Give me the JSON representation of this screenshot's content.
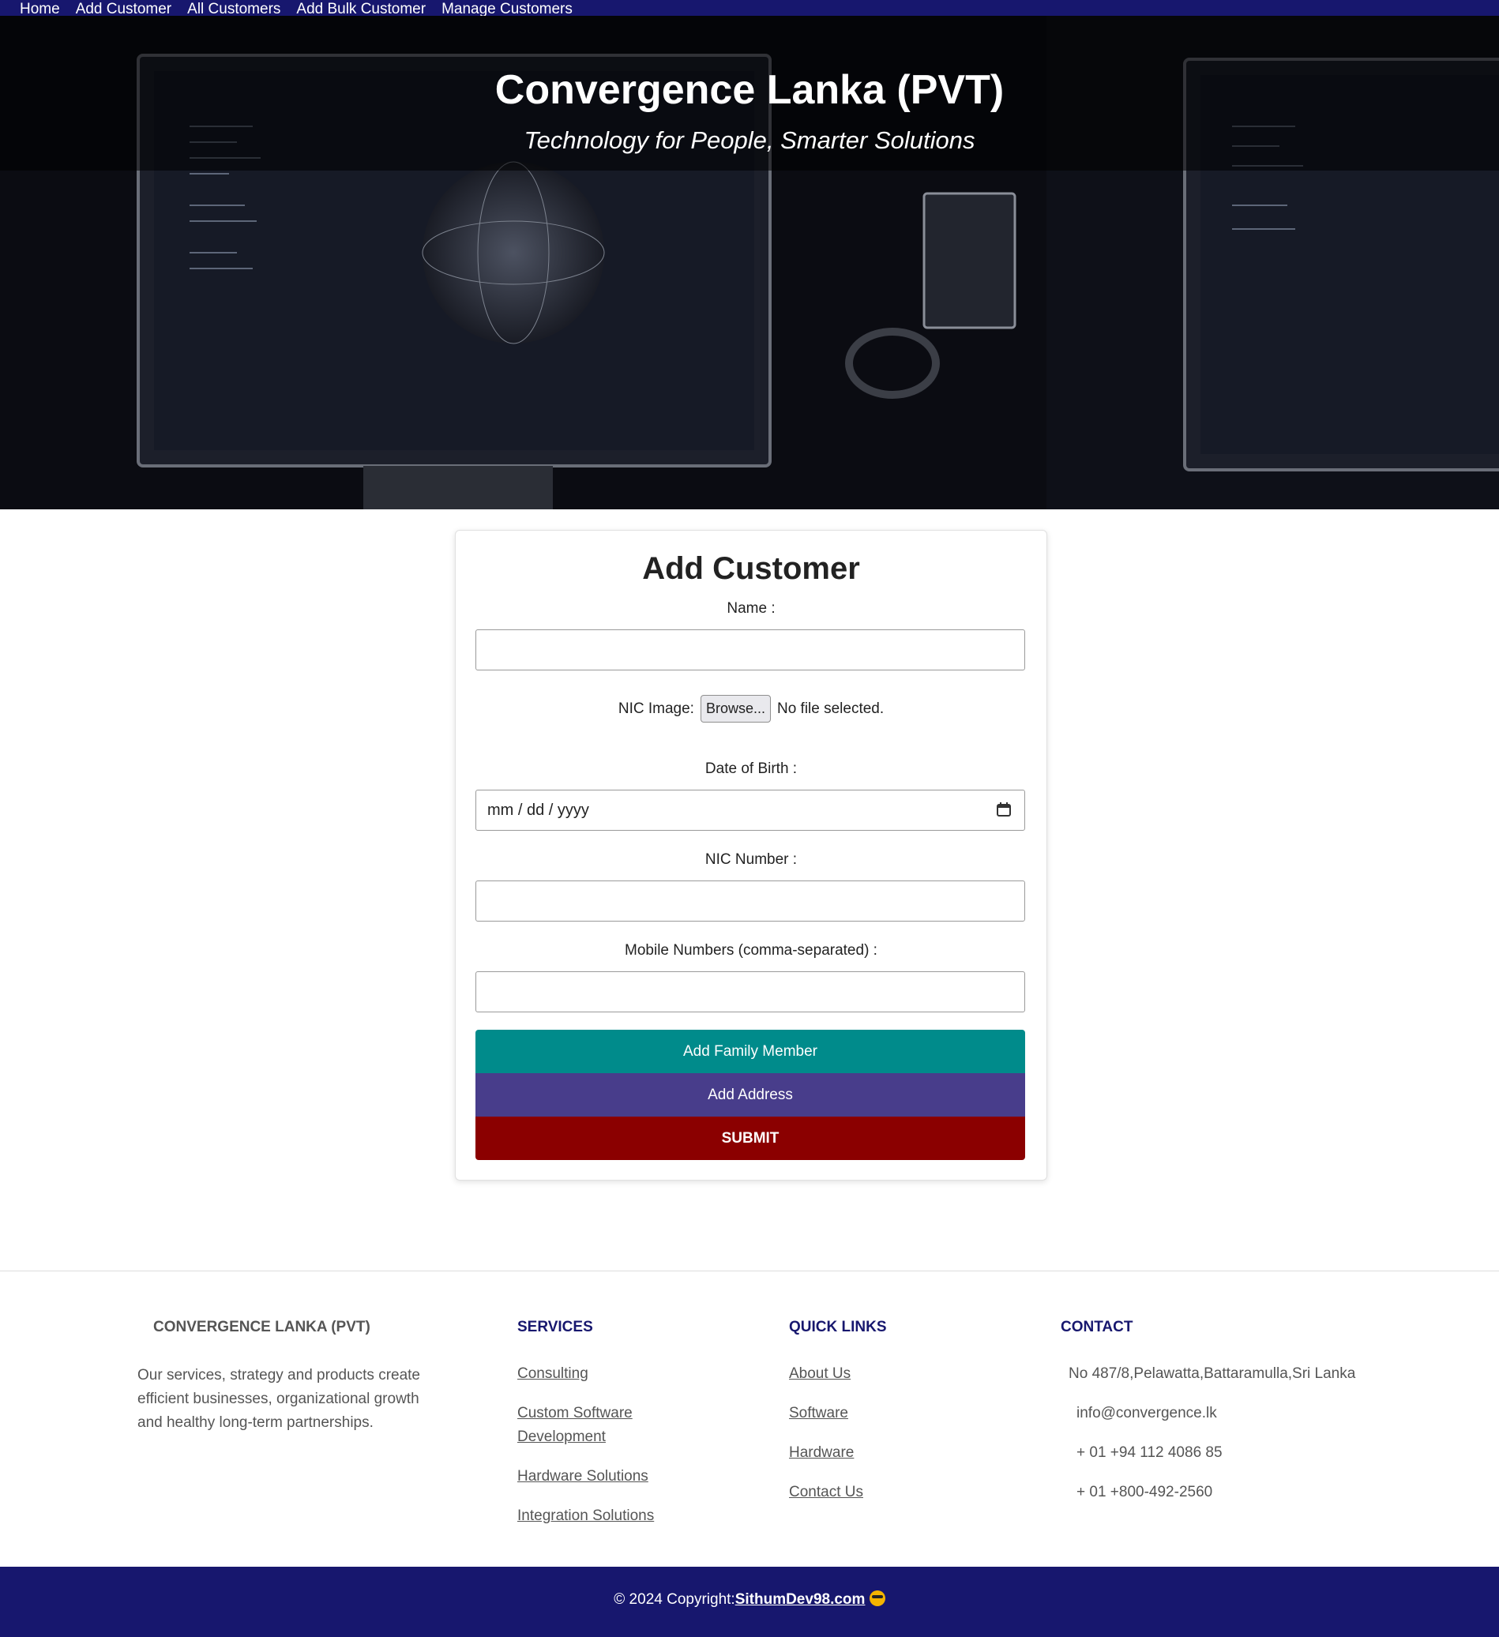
{
  "nav": {
    "items": [
      {
        "label": "Home"
      },
      {
        "label": "Add Customer"
      },
      {
        "label": "All Customers"
      },
      {
        "label": "Add Bulk Customer"
      },
      {
        "label": "Manage Customers"
      }
    ]
  },
  "hero": {
    "title": "Convergence Lanka (PVT)",
    "subtitle": "Technology for People, Smarter Solutions"
  },
  "form": {
    "title": "Add Customer",
    "name_label": "Name :",
    "nic_image_label": "NIC Image:",
    "browse_label": "Browse...",
    "file_status": "No file selected.",
    "dob_label": "Date of Birth :",
    "dob_placeholder": "mm / dd / yyyy",
    "nic_number_label": "NIC Number :",
    "mobile_label": "Mobile Numbers (comma-separated) :",
    "add_family_label": "Add Family Member",
    "add_address_label": "Add Address",
    "submit_label": "SUBMIT"
  },
  "footer": {
    "brand": "CONVERGENCE LANKA (PVT)",
    "description": "Our services, strategy and products create efficient businesses, organizational growth and healthy long-term partnerships.",
    "services_title": "SERVICES",
    "services": [
      "Consulting",
      "Custom Software Development",
      "Hardware Solutions",
      "Integration Solutions"
    ],
    "quick_links_title": "QUICK LINKS",
    "quick_links": [
      "About Us",
      "Software",
      "Hardware",
      "Contact Us"
    ],
    "contact_title": "CONTACT",
    "address": "No 487/8,Pelawatta,Battaramulla,Sri Lanka",
    "email": "info@convergence.lk",
    "phone1": "+ 01 +94 112 4086 85",
    "phone2": "+ 01 +800-492-2560",
    "copyright_prefix": "© 2024 Copyright:",
    "copyright_link": "SithumDev98.com"
  },
  "colors": {
    "nav_bg": "#17176e",
    "family_button": "#008b8b",
    "address_button": "#483d8b",
    "submit_button": "#8b0000"
  }
}
